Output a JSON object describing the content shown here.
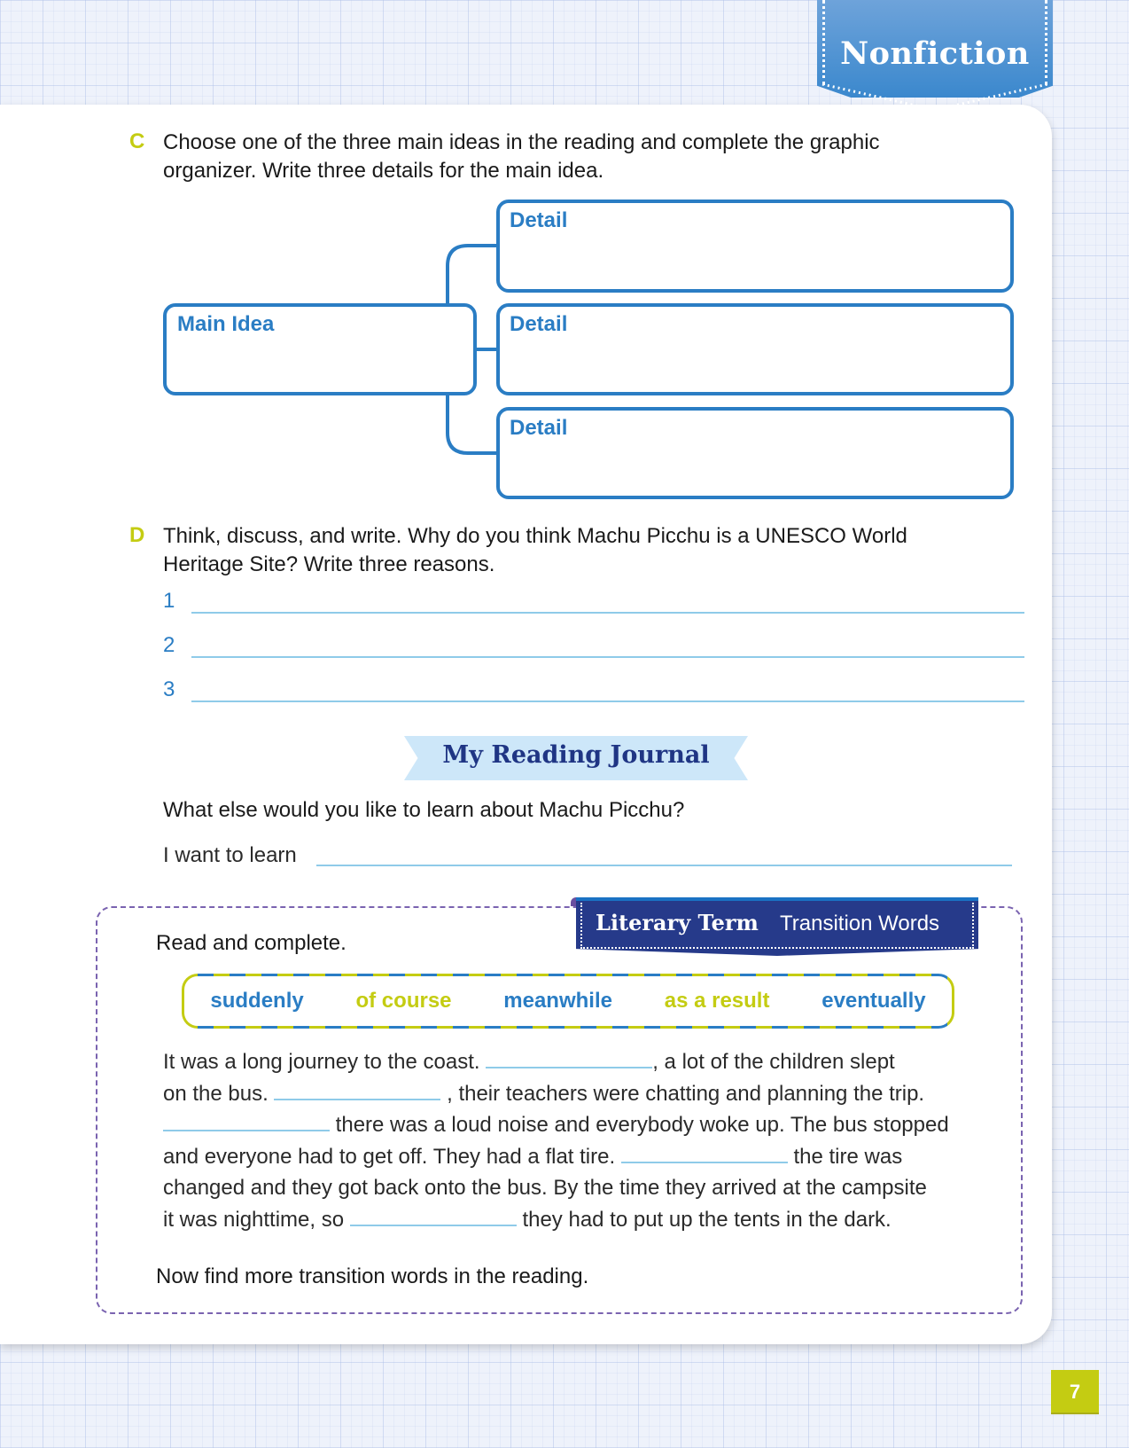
{
  "header": {
    "badge_label": "Nonfiction",
    "badge_icon": "ribbon-badge"
  },
  "colors": {
    "accent_blue": "#2a7dc4",
    "accent_lime": "#c4cc12",
    "navy": "#263a8a",
    "light_blue_line": "#8fcbe9",
    "dashed_purple": "#7a63b0"
  },
  "section_c": {
    "letter": "C",
    "instruction_line1": "Choose one of the three main ideas in the reading and complete the graphic",
    "instruction_line2": "organizer. Write three details for the main idea.",
    "organizer": {
      "main_label": "Main Idea",
      "detail_labels": [
        "Detail",
        "Detail",
        "Detail"
      ]
    }
  },
  "section_d": {
    "letter": "D",
    "instruction_line1": "Think, discuss, and write. Why do you think Machu Picchu is a UNESCO World",
    "instruction_line2": "Heritage Site? Write three reasons.",
    "answer_numbers": [
      "1",
      "2",
      "3"
    ]
  },
  "journal": {
    "title": "My Reading Journal",
    "question": "What else would you like to learn about Machu Picchu?",
    "prompt": "I want to learn"
  },
  "literary": {
    "tab_term": "Literary Term",
    "tab_topic": "Transition Words",
    "instruction": "Read and complete.",
    "word_bank": [
      {
        "word": "suddenly",
        "color": "#2a7dc4"
      },
      {
        "word": "of course",
        "color": "#c4cc12"
      },
      {
        "word": "meanwhile",
        "color": "#2a7dc4"
      },
      {
        "word": "as a result",
        "color": "#c4cc12"
      },
      {
        "word": "eventually",
        "color": "#2a7dc4"
      }
    ],
    "passage": {
      "l1a": "It was a long journey to the coast.",
      "l1b": ", a lot of the children slept",
      "l2a": "on the bus.",
      "l2b": ", their teachers were chatting and planning the trip.",
      "l3b": "there was a loud noise and everybody woke up. The bus stopped",
      "l4a": "and everyone had to get off. They had a flat tire.",
      "l4b": "the tire was",
      "l5": "changed and they got back onto the bus. By the time they arrived at the campsite",
      "l6a": "it was nighttime, so",
      "l6b": "they had to put up the tents in the dark."
    },
    "closing": "Now find more transition words in the reading."
  },
  "footer": {
    "page_number": "7"
  }
}
